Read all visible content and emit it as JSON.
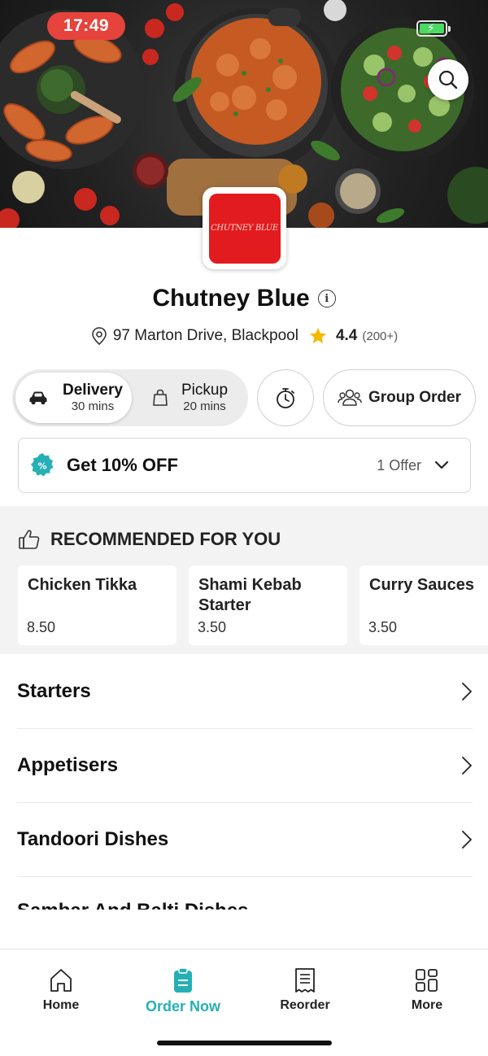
{
  "status_bar": {
    "time": "17:49"
  },
  "store": {
    "logo_text": "CHUTNEY BLUE",
    "name": "Chutney Blue",
    "address": "97 Marton Drive, Blackpool",
    "rating": "4.4",
    "reviews": "(200+)"
  },
  "order_mode": {
    "delivery": {
      "label": "Delivery",
      "time": "30 mins",
      "selected": true
    },
    "pickup": {
      "label": "Pickup",
      "time": "20 mins",
      "selected": false
    }
  },
  "group_order_label": "Group Order",
  "offer": {
    "title": "Get 10% OFF",
    "count": "1 Offer"
  },
  "recommended": {
    "title": "RECOMMENDED FOR YOU",
    "items": [
      {
        "name": "Chicken Tikka",
        "price": "8.50"
      },
      {
        "name": "Shami Kebab Starter",
        "price": "3.50"
      },
      {
        "name": "Curry Sauces",
        "price": "3.50"
      }
    ]
  },
  "categories": [
    "Starters",
    "Appetisers",
    "Tandoori Dishes",
    "Sambar And Balti Dishes"
  ],
  "tabs": [
    {
      "label": "Home",
      "icon": "home-icon",
      "active": false
    },
    {
      "label": "Order Now",
      "icon": "order-now-icon",
      "active": true
    },
    {
      "label": "Reorder",
      "icon": "receipt-icon",
      "active": false
    },
    {
      "label": "More",
      "icon": "grid-icon",
      "active": false
    }
  ],
  "colors": {
    "accent": "#26b0b5",
    "logo_red": "#e21b1f",
    "star": "#f5b800",
    "time_pill": "#e6433d"
  }
}
